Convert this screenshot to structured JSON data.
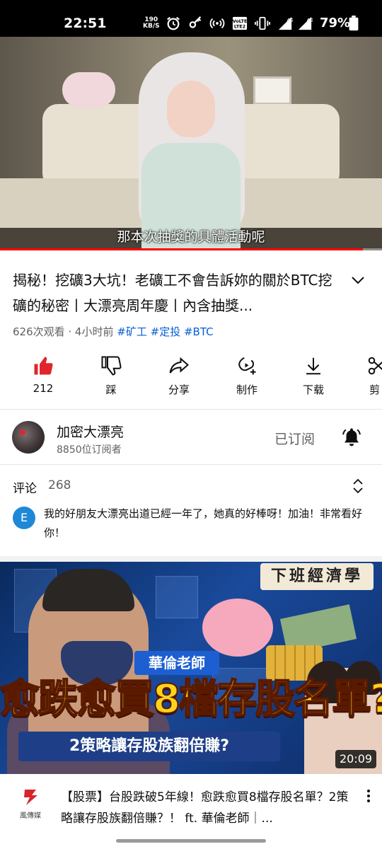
{
  "status_bar": {
    "time": "22:51",
    "net_speed_value": "190",
    "net_speed_unit": "KB/S",
    "battery": "79%"
  },
  "video": {
    "subtitle": "那本次抽獎的具體活動呢",
    "progress": 0.95
  },
  "title": {
    "text": "揭秘！挖礦3大坑！老礦工不會告訴妳的關於BTC挖礦的秘密丨大漂亮周年慶丨內含抽獎..."
  },
  "meta": {
    "views_time": "626次观看 · 4小时前",
    "tags": [
      "#矿工",
      "#定投",
      "#BTC"
    ]
  },
  "actions": {
    "like": "212",
    "dislike": "踩",
    "share": "分享",
    "create": "制作",
    "download": "下载",
    "clip": "剪"
  },
  "channel": {
    "name": "加密大漂亮",
    "subscribers": "8850位订阅者",
    "subscribed_label": "已订阅"
  },
  "comments": {
    "label": "评论",
    "count": "268",
    "top_comment_avatar": "E",
    "top_comment": "我的好朋友大漂亮出道已經一年了，她真的好棒呀！加油！非常看好你！"
  },
  "recommended": {
    "thumbnail": {
      "banner": "下班經濟學",
      "teacher": "華倫老師",
      "headline": "愈跌愈買8檔存股名單?",
      "subline": "2策略讓存股族翻倍賺?",
      "duration": "20:09"
    },
    "channel_logo_text": "風傳媒",
    "title": "【股票】台股跌破5年線！愈跌愈買8檔存股名單？2策略讓存股族翻倍賺？！ ft. 華倫老師｜..."
  },
  "colors": {
    "accent_red": "#ff0000",
    "link_blue": "#065fd4",
    "secondary_text": "#606060"
  }
}
